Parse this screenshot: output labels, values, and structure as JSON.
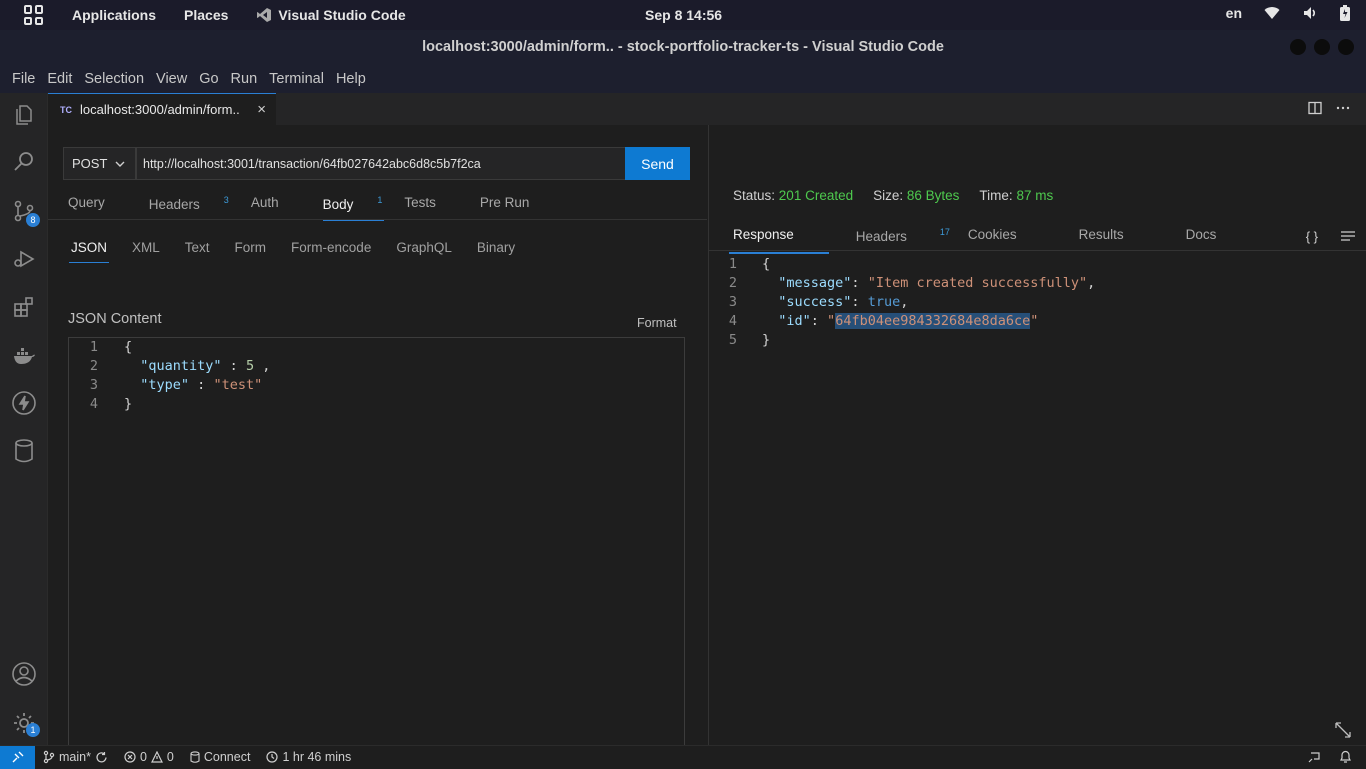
{
  "system": {
    "applications": "Applications",
    "places": "Places",
    "active_app": "Visual Studio Code",
    "clock": "Sep 8  14:56",
    "lang": "en"
  },
  "window": {
    "title": "localhost:3000/admin/form.. - stock-portfolio-tracker-ts - Visual Studio Code"
  },
  "menu": [
    "File",
    "Edit",
    "Selection",
    "View",
    "Go",
    "Run",
    "Terminal",
    "Help"
  ],
  "activity": {
    "scm_badge": "8",
    "settings_badge": "1"
  },
  "tab": {
    "icon": "TC",
    "label": "localhost:3000/admin/form.."
  },
  "request": {
    "method": "POST",
    "url": "http://localhost:3001/transaction/64fb027642abc6d8c5b7f2ca",
    "send_label": "Send",
    "tabs": [
      {
        "label": "Query",
        "count": ""
      },
      {
        "label": "Headers",
        "count": "3"
      },
      {
        "label": "Auth",
        "count": ""
      },
      {
        "label": "Body",
        "count": "1"
      },
      {
        "label": "Tests",
        "count": ""
      },
      {
        "label": "Pre Run",
        "count": ""
      }
    ],
    "body_tabs": [
      "JSON",
      "XML",
      "Text",
      "Form",
      "Form-encode",
      "GraphQL",
      "Binary"
    ],
    "json_label": "JSON Content",
    "format_label": "Format",
    "lines": [
      "1",
      "2",
      "3",
      "4"
    ],
    "code": {
      "open": "{",
      "quantity_key": "\"quantity\"",
      "quantity_sep": " : ",
      "quantity_val": "5",
      "quantity_end": " ,",
      "type_key": "\"type\"",
      "type_sep": " : ",
      "type_val": "\"test\"",
      "close": "}"
    }
  },
  "response": {
    "status_label": "Status:",
    "status_value": "201 Created",
    "size_label": "Size:",
    "size_value": "86 Bytes",
    "time_label": "Time:",
    "time_value": "87 ms",
    "tabs": [
      {
        "label": "Response",
        "count": ""
      },
      {
        "label": "Headers",
        "count": "17"
      },
      {
        "label": "Cookies",
        "count": ""
      },
      {
        "label": "Results",
        "count": ""
      },
      {
        "label": "Docs",
        "count": ""
      }
    ],
    "braces_icon": "{ }",
    "lines": [
      "1",
      "2",
      "3",
      "4",
      "5"
    ],
    "code": {
      "open": "{",
      "message_key": "\"message\"",
      "message_val": "\"Item created successfully\"",
      "success_key": "\"success\"",
      "success_val": "true",
      "id_key": "\"id\"",
      "id_quote": "\"",
      "id_val": "64fb04ee984332684e8da6ce",
      "close": "}"
    }
  },
  "statusbar": {
    "branch": "main*",
    "errors": "0",
    "warnings": "0",
    "connect": "Connect",
    "time": "1 hr 46 mins"
  },
  "colors": {
    "accent": "#0e7ad2",
    "status_ok": "#4ec94e",
    "badge": "#2a7fd4"
  }
}
